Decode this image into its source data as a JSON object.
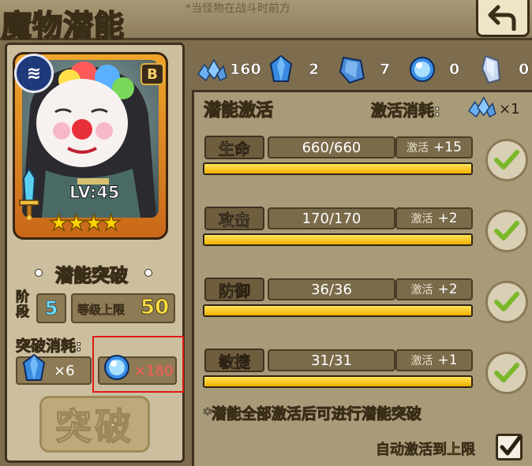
{
  "header": {
    "title": "魔物潜能",
    "subtitle": "*当怪物在战斗时前方"
  },
  "hero": {
    "rank": "B",
    "level": "LV:45",
    "stars": 4,
    "stars_text": "★★★★"
  },
  "breakthrough": {
    "title": "潜能突破",
    "stage_label": "阶段",
    "stage_value": "5",
    "level_cap_label": "等级上限",
    "level_cap_value": "50",
    "cost_label": "突破消耗:",
    "cost_items": [
      {
        "icon": "blue-crystal-icon",
        "amount": "×6"
      },
      {
        "icon": "blue-orb-icon",
        "amount": "×180"
      }
    ],
    "button_label": "突破"
  },
  "resources": [
    {
      "icon": "crystal-cluster-icon",
      "value": "160"
    },
    {
      "icon": "blue-crystal-icon",
      "value": "2"
    },
    {
      "icon": "large-crystal-icon",
      "value": "7"
    },
    {
      "icon": "blue-orb-icon",
      "value": "0"
    },
    {
      "icon": "pale-crystal-icon",
      "value": "0"
    }
  ],
  "potential": {
    "title": "潜能激活",
    "cost_label": "激活消耗:",
    "cost_value": "×1",
    "stats": [
      {
        "name": "生命",
        "value": "660/660",
        "activate_label": "激活",
        "bonus": "+15",
        "progress": 1.0
      },
      {
        "name": "攻击",
        "value": "170/170",
        "activate_label": "激活",
        "bonus": "+2",
        "progress": 1.0
      },
      {
        "name": "防御",
        "value": "36/36",
        "activate_label": "激活",
        "bonus": "+2",
        "progress": 1.0
      },
      {
        "name": "敏捷",
        "value": "31/31",
        "activate_label": "激活",
        "bonus": "+1",
        "progress": 1.0
      }
    ],
    "note": "*潜能全部激活后可进行潜能突破",
    "auto_label": "自动激活到上限",
    "auto_checked": true
  },
  "colors": {
    "gold_bar": "#f0b000",
    "highlight": "#e01818",
    "check_green": "#7ab82a"
  }
}
